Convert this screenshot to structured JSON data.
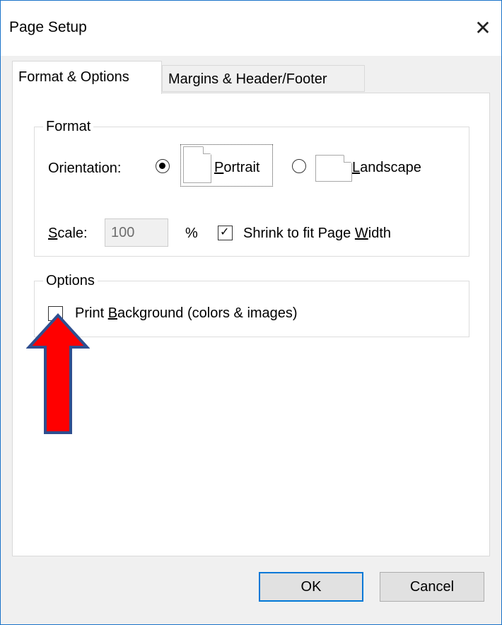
{
  "window": {
    "title": "Page Setup",
    "close_symbol": "✕"
  },
  "tabs": [
    {
      "label": "Format & Options",
      "active": true
    },
    {
      "label": "Margins & Header/Footer",
      "active": false
    }
  ],
  "format_group": {
    "title": "Format",
    "orientation_label": "Orientation:",
    "portrait": {
      "label_pre": "",
      "mnemonic": "P",
      "label_post": "ortrait",
      "selected": true
    },
    "landscape": {
      "label_pre": "",
      "mnemonic": "L",
      "label_post": "andscape",
      "selected": false
    },
    "scale_label_mnemonic": "S",
    "scale_label_rest": "cale:",
    "scale_value": "100",
    "percent_symbol": "%",
    "shrink_label_pre": "Shrink to fit Page ",
    "shrink_label_mnemonic": "W",
    "shrink_label_post": "idth",
    "shrink_checked": true
  },
  "options_group": {
    "title": "Options",
    "print_bg_pre": "Print ",
    "print_bg_mnemonic": "B",
    "print_bg_post": "ackground (colors & images)",
    "print_bg_checked": false
  },
  "buttons": {
    "ok": "OK",
    "cancel": "Cancel"
  },
  "annotation": {
    "arrow_icon": "red-up-arrow-icon",
    "arrow_fill": "#ff0000",
    "arrow_stroke": "#2f4f8f"
  },
  "colors": {
    "window_border": "#1a73c9",
    "default_button_border": "#0078d7"
  }
}
